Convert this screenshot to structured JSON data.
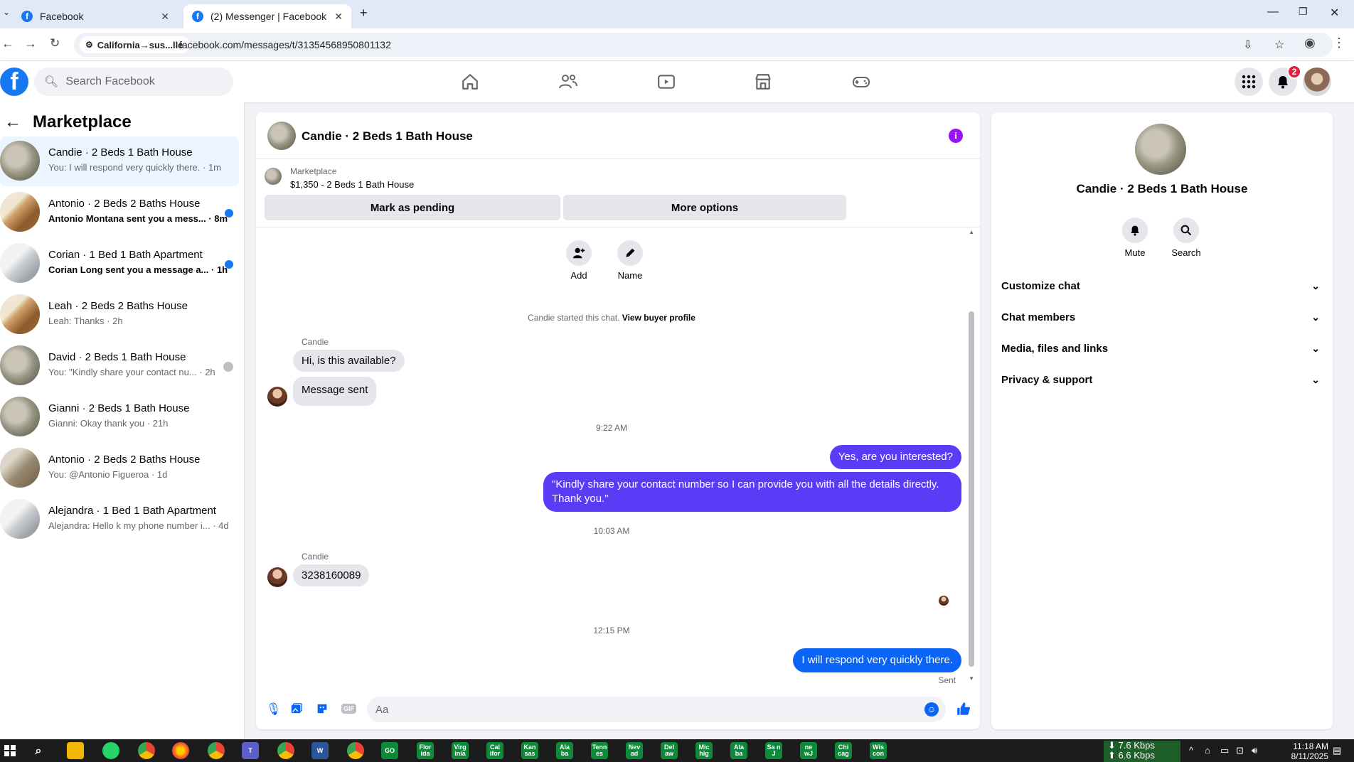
{
  "browser": {
    "tabs": [
      {
        "title": "Facebook",
        "icon": "facebook-icon"
      },
      {
        "title": "(2) Messenger | Facebook",
        "icon": "facebook-icon"
      }
    ],
    "site_chip": "California→sus...lle",
    "url": "facebook.com/messages/t/31354568950801132"
  },
  "header": {
    "search_placeholder": "Search Facebook",
    "notification_count": "2"
  },
  "marketplace": {
    "title": "Marketplace",
    "conversations": [
      {
        "name": "Candie · 2 Beds 1 Bath House",
        "snippet": "You: I will respond very quickly there. · 1m",
        "selected": true,
        "unread": false,
        "thumb": "img-green"
      },
      {
        "name": "Antonio · 2 Beds 2 Baths House",
        "snippet": "Antonio Montana sent you a mess... · 8m",
        "selected": false,
        "unread": true,
        "thumb": "img-wood"
      },
      {
        "name": "Corian · 1 Bed 1 Bath Apartment",
        "snippet": "Corian Long sent you a message a... · 1h",
        "selected": false,
        "unread": true,
        "thumb": "img-white"
      },
      {
        "name": "Leah · 2 Beds 2 Baths House",
        "snippet": "Leah: Thanks · 2h",
        "selected": false,
        "unread": false,
        "thumb": "img-wood"
      },
      {
        "name": "David · 2 Beds 1 Bath House",
        "snippet": "You: \"Kindly share your contact nu... · 2h",
        "selected": false,
        "unread": false,
        "seen": true,
        "thumb": "img-green"
      },
      {
        "name": "Gianni · 2 Beds 1 Bath House",
        "snippet": "Gianni: Okay thank you · 21h",
        "selected": false,
        "unread": false,
        "thumb": "img-green"
      },
      {
        "name": "Antonio · 2 Beds 2 Baths House",
        "snippet": "You: @Antonio Figueroa · 1d",
        "selected": false,
        "unread": false,
        "thumb": "img-room"
      },
      {
        "name": "Alejandra · 1 Bed 1 Bath Apartment",
        "snippet": "Alejandra: Hello k my phone number i... · 4d",
        "selected": false,
        "unread": false,
        "thumb": "img-white"
      }
    ]
  },
  "chat": {
    "title": "Candie · 2 Beds 1 Bath House",
    "listing_label": "Marketplace",
    "listing_price": "$1,350 - 2 Beds 1 Bath House",
    "mark_pending": "Mark as pending",
    "more_options": "More options",
    "add_label": "Add",
    "name_label": "Name",
    "started_text": "Candie started this chat.",
    "view_profile": "View buyer profile",
    "sender_name": "Candie",
    "msg_available": "Hi, is this available?",
    "msg_sent_card": "Message sent",
    "time_1": "9:22 AM",
    "msg_interested": "Yes, are you interested?",
    "msg_contact": "\"Kindly share your contact number so I can provide you with all the details directly. Thank you.\"",
    "time_2": "10:03 AM",
    "msg_phone": "3238160089",
    "time_3": "12:15 PM",
    "msg_respond": "I will respond very quickly there.",
    "sent_status": "Sent",
    "composer_placeholder": "Aa"
  },
  "details": {
    "name": "Candie · 2 Beds 1 Bath House",
    "mute": "Mute",
    "search": "Search",
    "sections": [
      "Customize chat",
      "Chat members",
      "Media, files and links",
      "Privacy & support"
    ]
  },
  "taskbar": {
    "net_down": "⬇ 7.6 Kbps",
    "net_up": "⬆ 6.6 Kbps",
    "time": "11:18 AM",
    "date": "8/11/2025",
    "apps": [
      {
        "label": "Flor ida"
      },
      {
        "label": "Virg inia"
      },
      {
        "label": "Cal ifor"
      },
      {
        "label": "Kan sas"
      },
      {
        "label": "Ala ba"
      },
      {
        "label": "Tenn es"
      },
      {
        "label": "Nev ad"
      },
      {
        "label": "Del aw"
      },
      {
        "label": "Mic hig"
      },
      {
        "label": "Ala ba"
      },
      {
        "label": "Sa n J"
      },
      {
        "label": "ne wJ"
      },
      {
        "label": "Chi cag"
      },
      {
        "label": "Wis con"
      }
    ]
  }
}
